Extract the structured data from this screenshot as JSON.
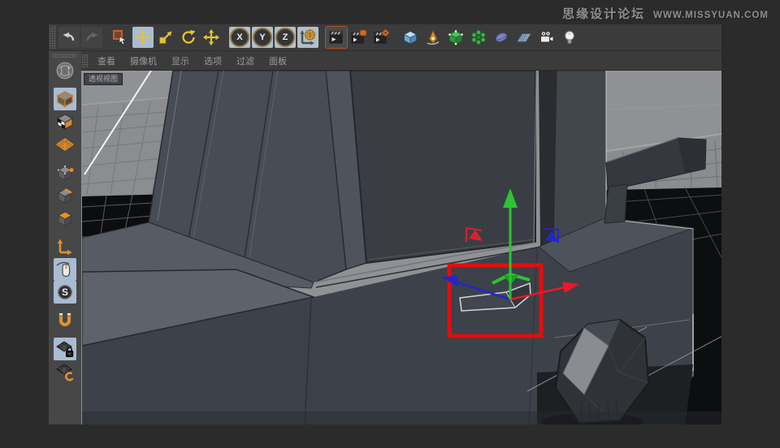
{
  "watermark": {
    "site_name": "思缘设计论坛",
    "site_url": "WWW.MISSYUAN.COM"
  },
  "toolbar": {
    "axis_letters": [
      "X",
      "Y",
      "Z"
    ],
    "active_tool": "move",
    "icons": [
      "undo-icon",
      "redo-icon",
      "live-selection-icon",
      "move-icon",
      "scale-icon",
      "rotate-icon",
      "last-tool-icon",
      "axis-x-lock",
      "axis-y-lock",
      "axis-z-lock",
      "coordinate-system-icon",
      "render-view-icon",
      "render-picture-viewer-icon",
      "render-settings-icon",
      "primitive-cube-icon",
      "spline-pen-icon",
      "subdivision-cube-icon",
      "deformer-icon",
      "environment-icon",
      "floor-icon",
      "camera-icon",
      "light-icon"
    ]
  },
  "menu_bar": {
    "items": [
      "查看",
      "摄像机",
      "显示",
      "选项",
      "过滤",
      "面板"
    ]
  },
  "viewport": {
    "label": "透视视图"
  },
  "sidebar": {
    "snap_letter": "S",
    "icons": [
      "make-editable-icon",
      "model-mode-icon",
      "texture-mode-icon",
      "workplane-icon",
      "points-mode-icon",
      "edges-mode-icon",
      "polygons-mode-icon",
      "enable-axis-icon",
      "tweak-mode-icon",
      "snap-toggle-icon",
      "magnet-icon",
      "lock-workplane-icon",
      "workplane-rotate-icon"
    ],
    "active": [
      "model-mode",
      "tweak-mode",
      "snap-toggle",
      "lock-workplane"
    ]
  },
  "gizmo": {
    "axes": [
      {
        "name": "X",
        "color": "#e51a2b"
      },
      {
        "name": "Y",
        "color": "#2bc434"
      },
      {
        "name": "Z",
        "color": "#2326c9"
      }
    ]
  },
  "annotation": {
    "type": "highlight-rectangle",
    "color": "#e40d0d"
  },
  "colors": {
    "highlight_red": "#e40d0d",
    "active_tool_bg": "#a8bcd4",
    "tool_yellow": "#e3c23a",
    "sidebar_orange": "#e09030",
    "viewport_sky": "#8f9195",
    "model_body": "#3d4149"
  }
}
